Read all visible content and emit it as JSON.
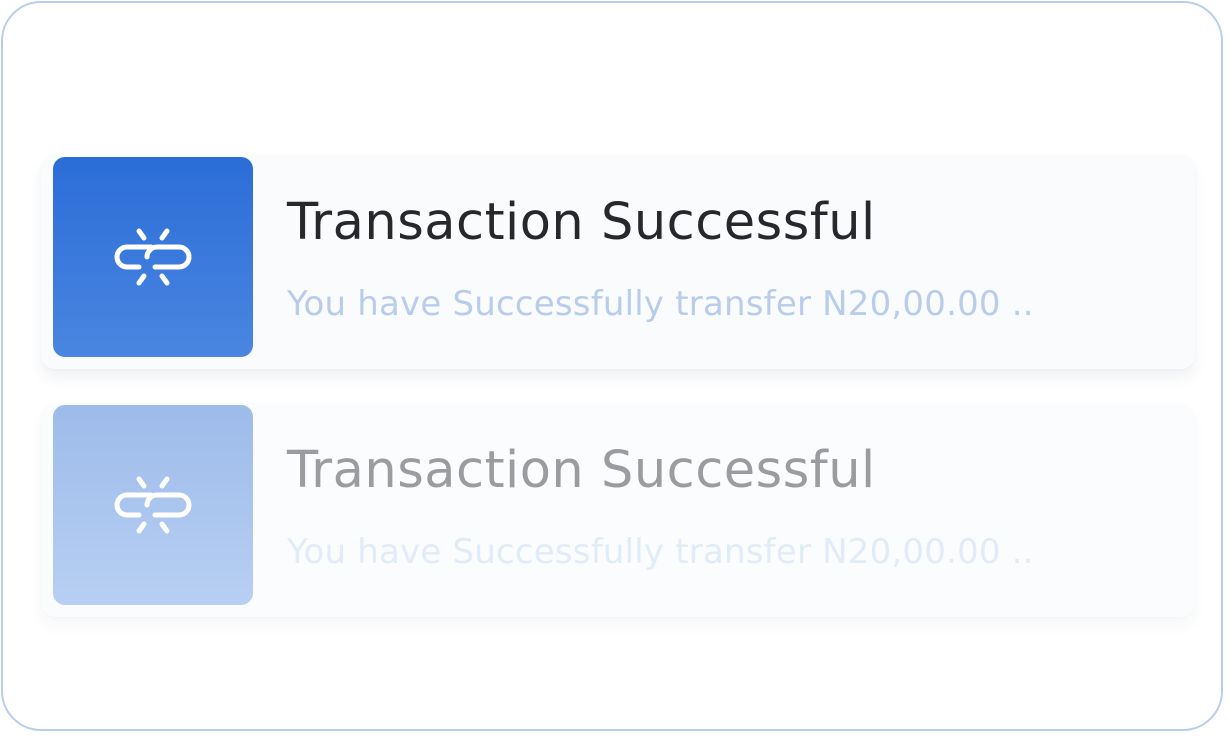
{
  "notifications": [
    {
      "icon": "link-icon",
      "title": "Transaction Successful",
      "message": "You have Successfully transfer N20,00.00 .."
    },
    {
      "icon": "link-icon",
      "title": "Transaction Successful",
      "message": "You have Successfully transfer N20,00.00 .."
    }
  ],
  "colors": {
    "accent": "#2b6dd8",
    "accent_faded": "#a9c4ee",
    "border": "#b7cdee"
  }
}
